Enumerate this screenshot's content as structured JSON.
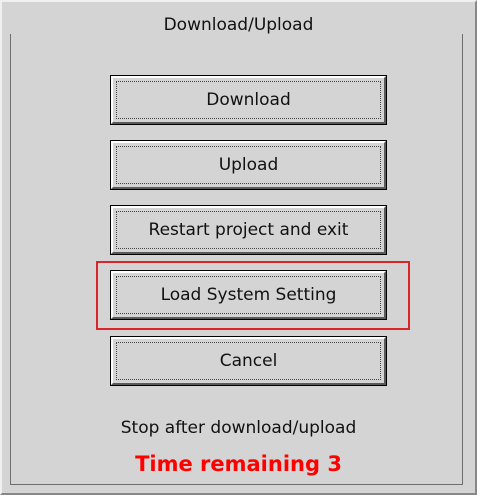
{
  "dialog": {
    "title": "Download/Upload",
    "buttons": {
      "download": "Download",
      "upload": "Upload",
      "restart": "Restart project and exit",
      "load_system_setting": "Load System Setting",
      "cancel": "Cancel"
    },
    "note": "Stop after download/upload",
    "timer": "Time remaining 3",
    "colors": {
      "background": "#d4d4d4",
      "highlight": "#d9262b",
      "timer": "#ff0000"
    }
  }
}
